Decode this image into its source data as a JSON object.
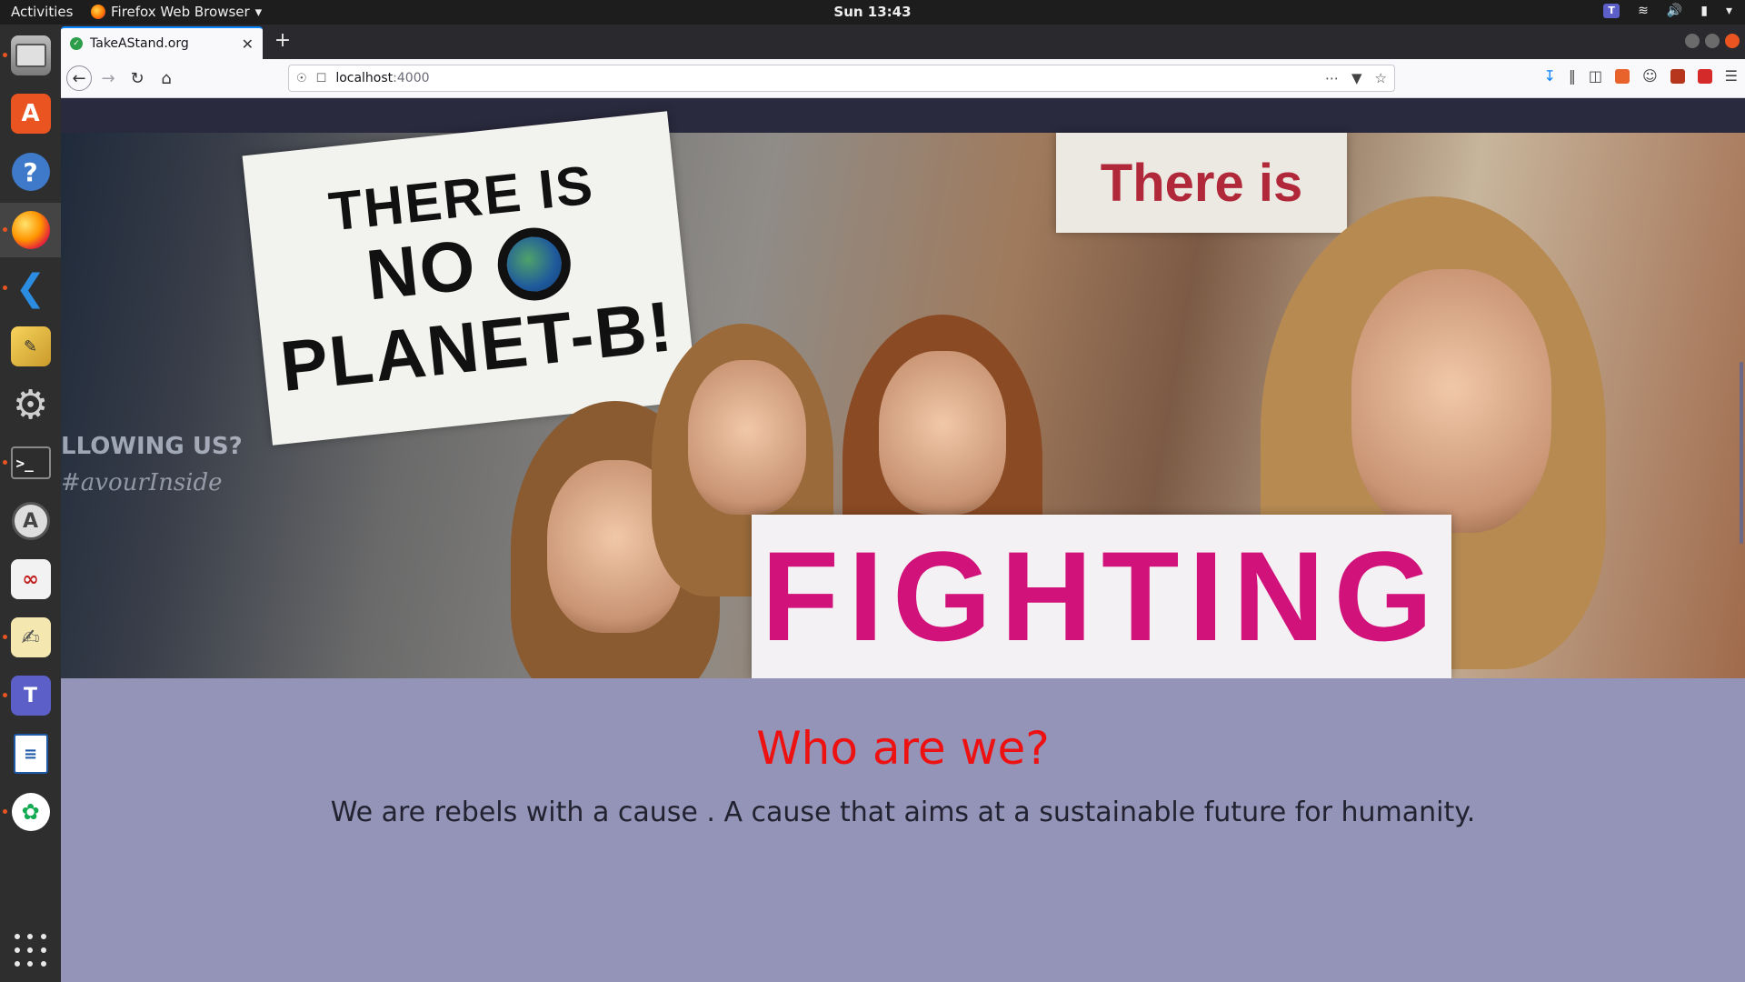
{
  "topbar": {
    "activities": "Activities",
    "app_menu": "Firefox Web Browser",
    "clock": "Sun 13:43"
  },
  "dock": {
    "items": [
      "files-icon",
      "software-store-icon",
      "help-icon",
      "firefox-icon",
      "vscode-icon",
      "drawing-icon",
      "settings-tools-icon",
      "terminal-icon",
      "software-updater-icon",
      "app-icon",
      "text-editor-icon",
      "teams-icon",
      "writer-icon",
      "mongodb-compass-icon",
      "show-apps-icon"
    ]
  },
  "browser": {
    "tab_title": "TakeAStand.org",
    "url_host": "localhost",
    "url_port": ":4000"
  },
  "hero": {
    "sign_left_line1": "THERE IS",
    "sign_left_line2": "NO",
    "sign_left_line3": "PLANET-B!",
    "sign_right": "There is",
    "sign_bottom": "FIGHTING",
    "wall_text_1": "LLOWING US?",
    "wall_text_2": "#avourInside"
  },
  "about": {
    "heading": "Who are we?",
    "text": "We are rebels with a cause . A cause that aims at a sustainable future for humanity."
  },
  "colors": {
    "heading": "#ee1111",
    "section_bg": "#9494b8",
    "nav_bg": "#2a2a3e",
    "sign_bottom_text": "#d1127a"
  }
}
